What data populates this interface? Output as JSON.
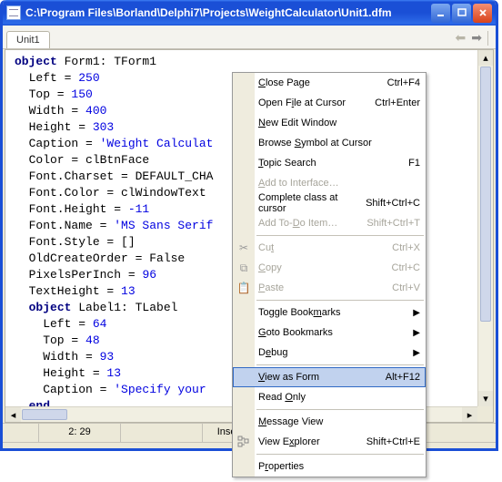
{
  "titlebar": {
    "title": "C:\\Program Files\\Borland\\Delphi7\\Projects\\WeightCalculator\\Unit1.dfm"
  },
  "tab": {
    "label": "Unit1"
  },
  "code": {
    "l1a": "object",
    "l1b": " Form1: TForm1",
    "l2a": "  Left = ",
    "l2b": "250",
    "l3a": "  Top = ",
    "l3b": "150",
    "l4a": "  Width = ",
    "l4b": "400",
    "l5a": "  Height = ",
    "l5b": "303",
    "l6a": "  Caption = ",
    "l6b": "'Weight Calculat",
    "l7a": "  Color = clBtnFace",
    "l8a": "  Font.Charset = DEFAULT_CHA",
    "l9a": "  Font.Color = clWindowText",
    "l10a": "  Font.Height = ",
    "l10b": "-11",
    "l11a": "  Font.Name = ",
    "l11b": "'MS Sans Serif",
    "l12a": "  Font.Style = []",
    "l13a": "  OldCreateOrder = False",
    "l14a": "  PixelsPerInch = ",
    "l14b": "96",
    "l15a": "  TextHeight = ",
    "l15b": "13",
    "l16a": "  ",
    "l16b": "object",
    "l16c": " Label1: TLabel",
    "l17a": "    Left = ",
    "l17b": "64",
    "l18a": "    Top = ",
    "l18b": "48",
    "l19a": "    Width = ",
    "l19b": "93",
    "l20a": "    Height = ",
    "l20b": "13",
    "l21a": "    Caption = ",
    "l21b": "'Specify your ",
    "l22a": "  ",
    "l22b": "end"
  },
  "status": {
    "pos": "2: 29",
    "mode": "Insert"
  },
  "menu": {
    "close_page": "Close Page",
    "close_page_sc": "Ctrl+F4",
    "open_file": "Open File at Cursor",
    "open_file_sc": "Ctrl+Enter",
    "new_edit": "New Edit Window",
    "browse_symbol": "Browse Symbol at Cursor",
    "topic_search": "Topic Search",
    "topic_search_sc": "F1",
    "add_interface": "Add to Interface…",
    "complete_class": "Complete class at cursor",
    "complete_class_sc": "Shift+Ctrl+C",
    "add_todo": "Add To-Do Item…",
    "add_todo_sc": "Shift+Ctrl+T",
    "cut": "Cut",
    "cut_sc": "Ctrl+X",
    "copy": "Copy",
    "copy_sc": "Ctrl+C",
    "paste": "Paste",
    "paste_sc": "Ctrl+V",
    "toggle_bm": "Toggle Bookmarks",
    "goto_bm": "Goto Bookmarks",
    "debug": "Debug",
    "view_form": "View as Form",
    "view_form_sc": "Alt+F12",
    "read_only": "Read Only",
    "message_view": "Message View",
    "view_explorer": "View Explorer",
    "view_explorer_sc": "Shift+Ctrl+E",
    "properties": "Properties"
  }
}
